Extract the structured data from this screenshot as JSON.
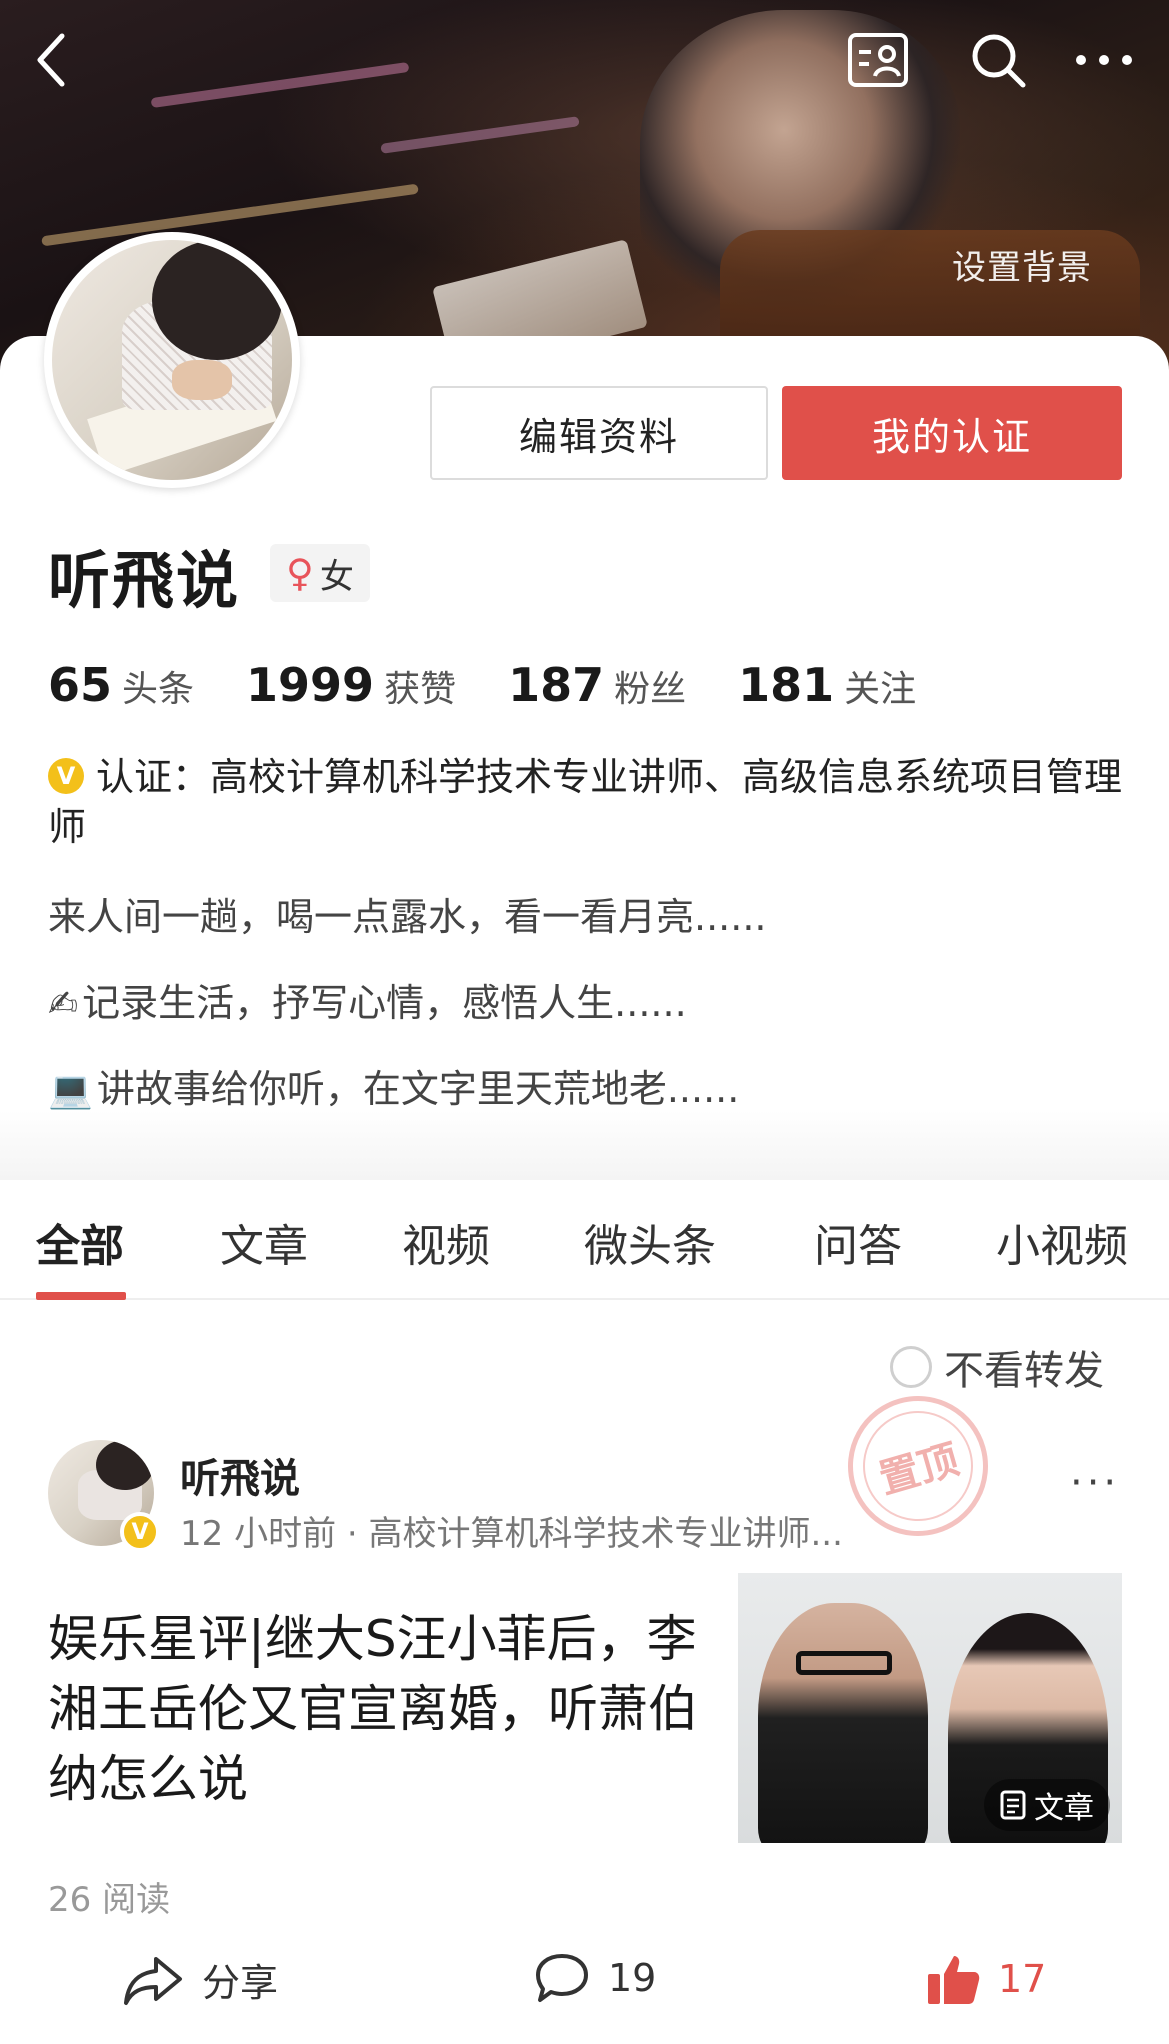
{
  "header": {
    "set_background_label": "设置背景"
  },
  "profile": {
    "name": "听飛说",
    "gender": "女",
    "edit_button": "编辑资料",
    "verify_button": "我的认证",
    "stats": [
      {
        "num": "65",
        "label": "头条"
      },
      {
        "num": "1999",
        "label": "获赞"
      },
      {
        "num": "187",
        "label": "粉丝"
      },
      {
        "num": "181",
        "label": "关注"
      }
    ],
    "verification_badge": "V",
    "verification": "认证：高校计算机科学技术专业讲师、高级信息系统项目管理师",
    "bio": [
      "来人间一趟，喝一点露水，看一看月亮......",
      "记录生活，抒写心情，感悟人生......",
      "讲故事给你听，在文字里天荒地老......"
    ]
  },
  "tabs": [
    "全部",
    "文章",
    "视频",
    "微头条",
    "问答",
    "小视频"
  ],
  "filter": {
    "label": "不看转发"
  },
  "post": {
    "pinned_stamp": "置顶",
    "author": "听飛说",
    "author_badge": "V",
    "meta": "12 小时前 · 高校计算机科学技术专业讲师...",
    "title": "娱乐星评|继大S汪小菲后，李湘王岳伦又官宣离婚，听萧伯纳怎么说",
    "thumb_tag": "文章",
    "reads": "26 阅读",
    "more": "···",
    "actions": {
      "share": "分享",
      "comments": "19",
      "likes": "17"
    }
  },
  "colors": {
    "accent": "#e0504a",
    "verify_badge": "#f3c01a"
  }
}
